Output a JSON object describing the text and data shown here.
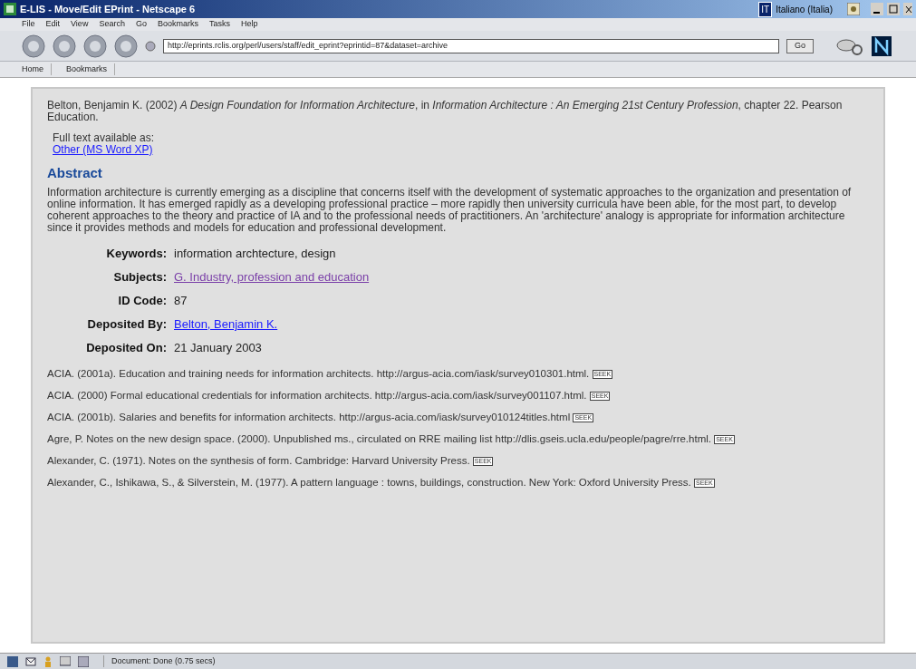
{
  "window": {
    "title": "E-LIS - Move/Edit EPrint - Netscape 6",
    "language": "Italiano (Italia)",
    "language_code": "IT"
  },
  "menu": [
    "File",
    "Edit",
    "View",
    "Search",
    "Go",
    "Bookmarks",
    "Tasks",
    "Help"
  ],
  "address": {
    "value": "http://eprints.rclis.org/perl/users/staff/edit_eprint?eprintid=87&dataset=archive",
    "go": "Go"
  },
  "personal_toolbar": [
    "Home",
    "Bookmarks"
  ],
  "citation": "Belton, Benjamin K. (2002) *A Design Foundation for Information Architecture*, in *Information Architecture : An Emerging 21st Century Profession*, chapter 22. Pearson Education.",
  "full_text": {
    "label": "Full text available as:",
    "link": "Other (MS Word XP)"
  },
  "abstract": {
    "heading": "Abstract",
    "text": "Information architecture is currently emerging as a discipline that concerns itself with the development of systematic approaches to the organization and presentation of online information. It has emerged rapidly as a developing professional practice – more rapidly then university curricula have been able, for the most part, to develop coherent approaches to the theory and practice of IA and to the professional needs of practitioners. An 'architecture' analogy is appropriate for information architecture since it provides methods and models for education and professional development."
  },
  "fields": [
    {
      "label": "Keywords:",
      "value": "information archtecture, design",
      "kind": "text"
    },
    {
      "label": "Subjects:",
      "value": "G. Industry, profession and education",
      "kind": "visited_link"
    },
    {
      "label": "ID Code:",
      "value": "87",
      "kind": "text"
    },
    {
      "label": "Deposited By:",
      "value": "Belton, Benjamin K.",
      "kind": "link"
    },
    {
      "label": "Deposited On:",
      "value": "21 January 2003",
      "kind": "text"
    }
  ],
  "references": [
    {
      "text": "ACIA. (2001a). Education and training needs for information architects. http://argus-acia.com/iask/survey010301.html.",
      "badge": "SEEK"
    },
    {
      "text": "ACIA. (2000) Formal educational credentials for information architects. http://argus-acia.com/iask/survey001107.html.",
      "badge": "SEEK"
    },
    {
      "text": "ACIA. (2001b). Salaries and benefits for information architects. http://argus-acia.com/iask/survey010124titles.html",
      "badge": "SEEK"
    },
    {
      "text": "Agre, P. Notes on the new design space. (2000). Unpublished ms., circulated on RRE mailing list http://dlis.gseis.ucla.edu/people/pagre/rre.html.",
      "badge": "SEEK"
    },
    {
      "text": "Alexander, C. (1971). Notes on the synthesis of form. Cambridge: Harvard University Press.",
      "badge": "SEEK"
    },
    {
      "text": "Alexander, C., Ishikawa, S., & Silverstein, M. (1977). A pattern language : towns, buildings, construction. New York: Oxford University Press.",
      "badge": "SEEK"
    }
  ],
  "status_bar": {
    "text": "Document: Done (0.75 secs)"
  }
}
